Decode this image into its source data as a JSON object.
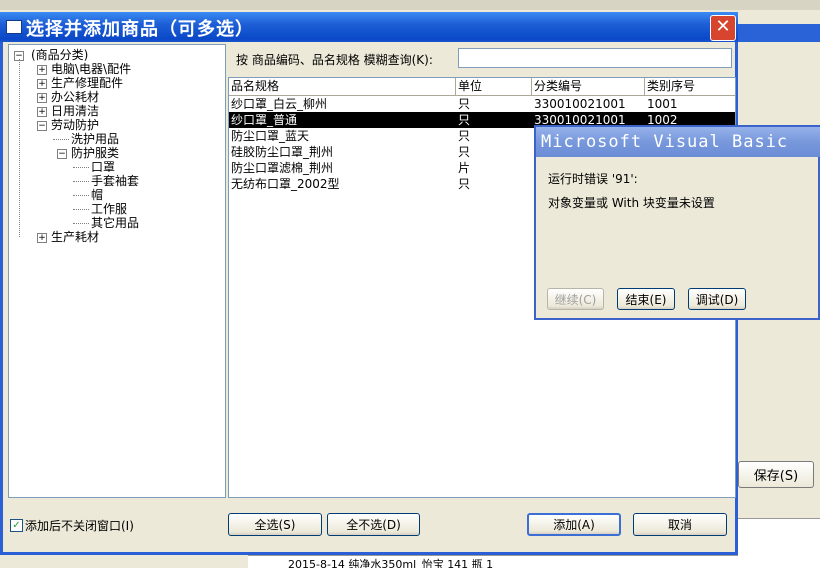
{
  "dialog": {
    "title": "选择并添加商品（可多选）",
    "close_label": "✕"
  },
  "tree": {
    "root": "(商品分类)",
    "nodes": [
      {
        "label": "电脑\\电器\\配件",
        "expander": "+"
      },
      {
        "label": "生产修理配件",
        "expander": "+"
      },
      {
        "label": "办公耗材",
        "expander": "+"
      },
      {
        "label": "日用清洁",
        "expander": "+"
      },
      {
        "label": "劳动防护",
        "expander": "−"
      },
      {
        "label": "洗护用品",
        "expander": ""
      },
      {
        "label": "防护服类",
        "expander": "−"
      },
      {
        "label": "口罩",
        "expander": ""
      },
      {
        "label": "手套袖套",
        "expander": ""
      },
      {
        "label": "帽",
        "expander": ""
      },
      {
        "label": "工作服",
        "expander": ""
      },
      {
        "label": "其它用品",
        "expander": ""
      },
      {
        "label": "生产耗材",
        "expander": "+"
      }
    ]
  },
  "search": {
    "label": "按 商品编码、品名规格 模糊查询(K):",
    "value": ""
  },
  "list": {
    "columns": [
      "品名规格",
      "单位",
      "分类编号",
      "类别序号"
    ],
    "rows": [
      [
        "纱口罩_白云_柳州",
        "只",
        "330010021001",
        "1001"
      ],
      [
        "纱口罩_普通",
        "只",
        "330010021001",
        "1002"
      ],
      [
        "防尘口罩_蓝天",
        "只",
        "",
        ""
      ],
      [
        "硅胶防尘口罩_荆州",
        "只",
        "",
        ""
      ],
      [
        "防尘口罩滤棉_荆州",
        "片",
        "",
        ""
      ],
      [
        "无纺布口罩_2002型",
        "只",
        "",
        ""
      ]
    ],
    "selected_row": 1
  },
  "footer": {
    "keep_open_label": "添加后不关闭窗口(I)",
    "keep_open_checked": "✓",
    "select_all": "全选(S)",
    "select_none": "全不选(D)",
    "add": "添加(A)",
    "cancel": "取消"
  },
  "error_dialog": {
    "title": "Microsoft Visual Basic",
    "line1": "运行时错误 '91':",
    "line2": "对象变量或 With 块变量未设置",
    "continue": "继续(C)",
    "end": "结束(E)",
    "debug": "调试(D)"
  },
  "background": {
    "save_button": "保存(S)",
    "bottom_row": "2015-8-14  纯净水350ml_怡宝          141  瓶   1"
  },
  "colors": {
    "title_blue": "#0a48c8",
    "close_red": "#d8452f",
    "selection": "#000000",
    "error_title": "#7898dc"
  }
}
